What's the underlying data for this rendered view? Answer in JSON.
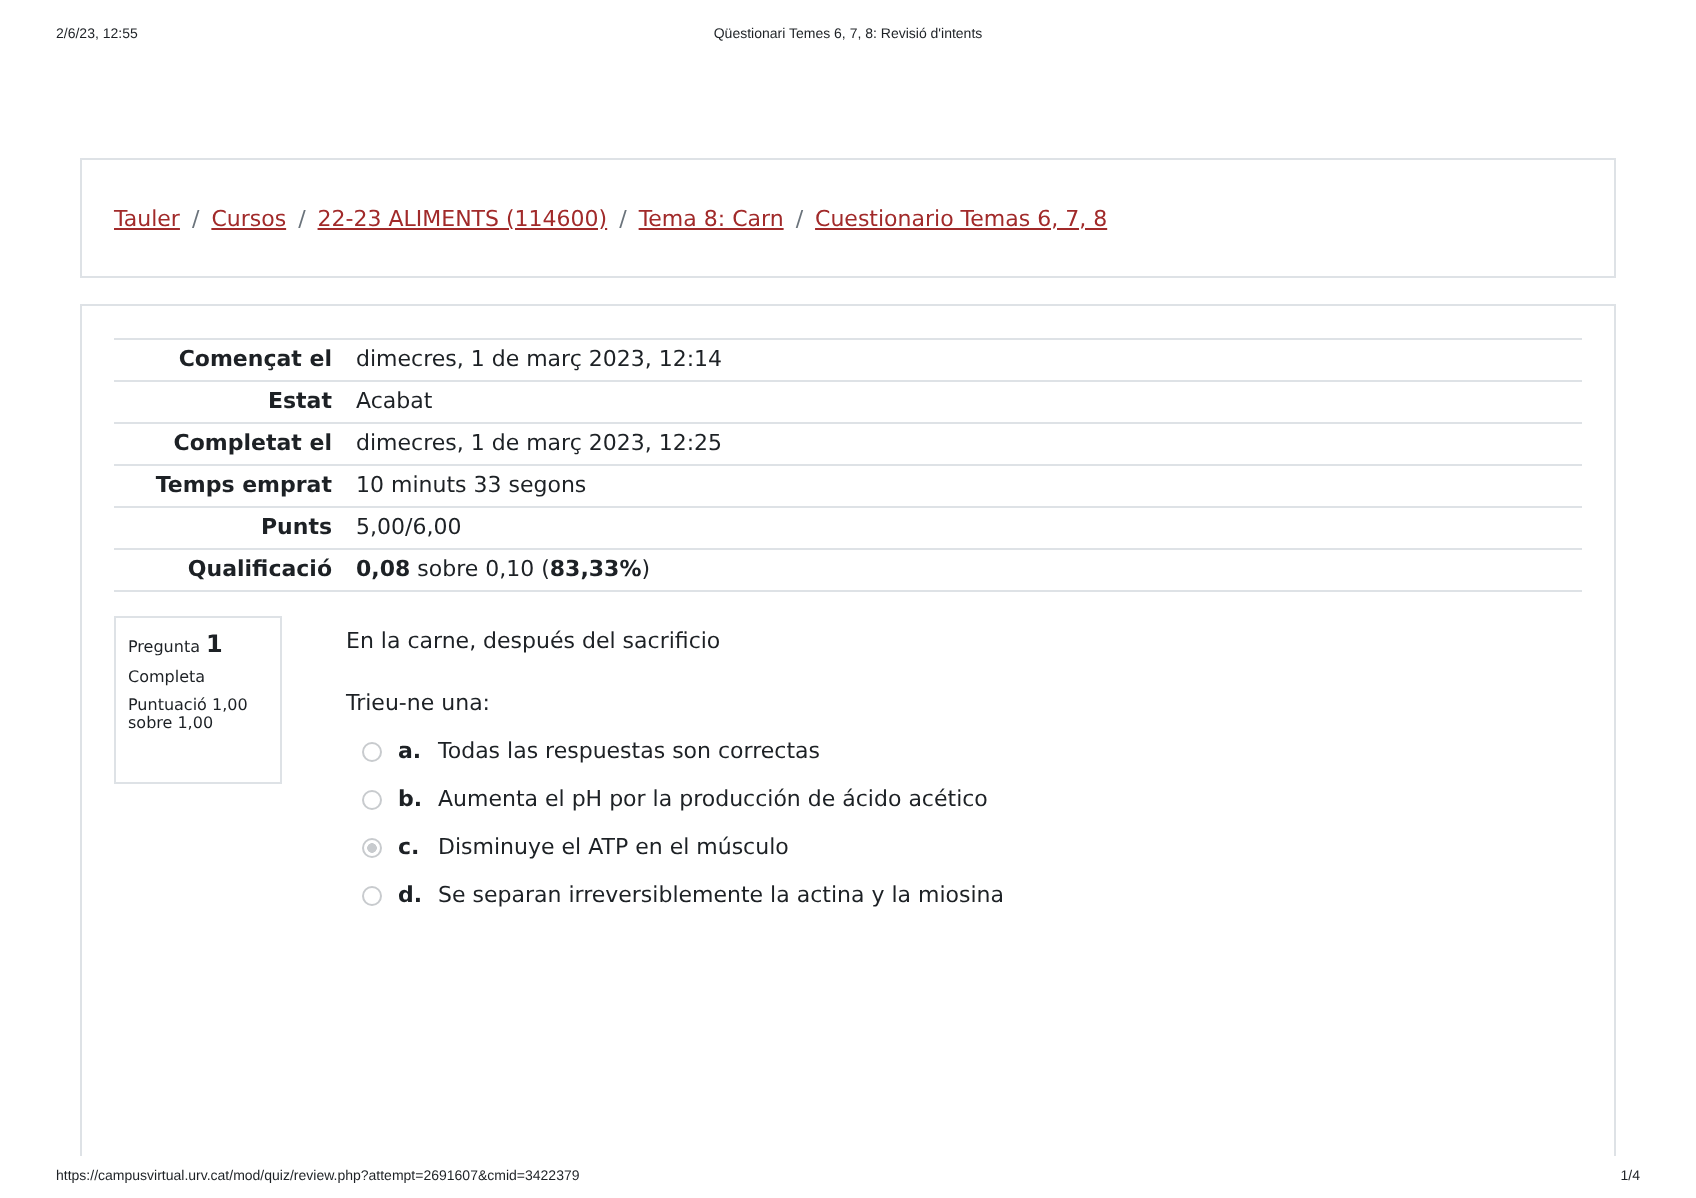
{
  "print_header": {
    "date": "2/6/23, 12:55",
    "title": "Qüestionari Temes 6, 7, 8: Revisió d'intents"
  },
  "breadcrumb": [
    {
      "label": "Tauler"
    },
    {
      "separator": "/",
      "label": "Cursos"
    },
    {
      "separator": "/",
      "label": "22-23 ALIMENTS (114600)"
    },
    {
      "separator": "/",
      "label": "Tema 8: Carn"
    },
    {
      "separator": "/",
      "label": "Cuestionario Temas 6, 7, 8"
    }
  ],
  "summary": [
    {
      "label": "Començat el",
      "value": "dimecres, 1 de març 2023, 12:14"
    },
    {
      "label": "Estat",
      "value": "Acabat"
    },
    {
      "label": "Completat el",
      "value": "dimecres, 1 de març 2023, 12:25"
    },
    {
      "label": "Temps emprat",
      "value": "10 minuts 33 segons"
    },
    {
      "label": "Punts",
      "value": "5,00/6,00"
    },
    {
      "label": "Qualificació",
      "value": "**0,08** sobre 0,10 (**83,33%**)"
    }
  ],
  "question": {
    "label": "Pregunta",
    "number": "1",
    "status": "Completa",
    "score": "Puntuació 1,00 sobre 1,00",
    "text": "En la carne, después del sacrificio",
    "prompt": "Trieu-ne una:",
    "options": [
      {
        "letter": "a.",
        "text": "Todas las respuestas son correctas",
        "selected": false
      },
      {
        "letter": "b.",
        "text": "Aumenta el pH por la producción de ácido acético",
        "selected": false
      },
      {
        "letter": "c.",
        "text": "Disminuye el ATP en el músculo",
        "selected": true
      },
      {
        "letter": "d.",
        "text": "Se separan irreversiblemente la actina y la miosina",
        "selected": false
      }
    ]
  },
  "print_footer": {
    "url": "https://campusvirtual.urv.cat/mod/quiz/review.php?attempt=2691607&cmid=3422379",
    "page": "1/4"
  }
}
